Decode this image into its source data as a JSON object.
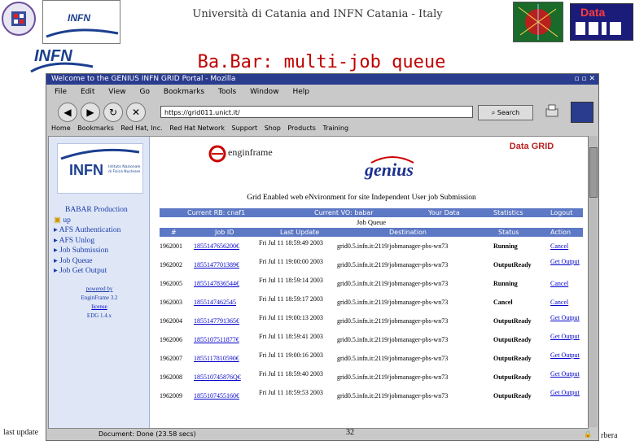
{
  "slide": {
    "header": "Università di Catania and INFN Catania - Italy",
    "title": "Ba.Bar: multi-job queue",
    "infn_logo": "INFN",
    "infn_logo2": "INFN",
    "datagrid_label": "Data",
    "footer_left": "last update",
    "page_number": "32",
    "footer_right": "rbera"
  },
  "browser": {
    "window_title": "Welcome to the GENIUS INFN GRID Portal - Mozilla",
    "menu": [
      "File",
      "Edit",
      "View",
      "Go",
      "Bookmarks",
      "Tools",
      "Window",
      "Help"
    ],
    "url": "https://grid011.unict.it/",
    "search_label": "Search",
    "bookmarks": [
      "Home",
      "Bookmarks",
      "Red Hat, Inc.",
      "Red Hat Network",
      "Support",
      "Shop",
      "Products",
      "Training"
    ],
    "status_text": "Document: Done (23.58 secs)"
  },
  "portal": {
    "sidebar_logo": "INFN",
    "sidebar_logo_sub": "Istituto Nazionale di Fisica Nucleare",
    "menu": [
      "BABAR Production",
      "up",
      "AFS Authentication",
      "AFS Unlog",
      "Job Submission",
      "Job Queue",
      "Job Get Output"
    ],
    "powered_by": "powered by",
    "engine": "EnginFrame 3.2",
    "engine_link": "license",
    "edg": "EDG 1.4.x",
    "enginframe_logo": "enginframe",
    "genius_logo": "genius",
    "banner": "Grid Enabled web eNvironment for site Independent User job Submission",
    "datagrid_logo": "Data GRID",
    "nav": [
      "Current RB: cnaf1",
      "Current VO: babar",
      "Your Data",
      "Statistics",
      "Logout"
    ],
    "queue_title": "Job Queue",
    "columns": [
      "#",
      "Job ID",
      "Last Update",
      "Destination",
      "Status",
      "Action"
    ],
    "rows": [
      {
        "num": "1962001",
        "jobid": "1855147656200€",
        "date": "Fri Jul 11 18:59:49 2003",
        "dest": "grid0.5.infn.it:2119/jobmanager-pbs-wn73",
        "status": "Running",
        "action": "Cancel"
      },
      {
        "num": "1962002",
        "jobid": "1855147701389€",
        "date": "Fri Jul 11 19:00:00 2003",
        "dest": "grid0.5.infn.it:2119/jobmanager-pbs-wn73",
        "status": "OutputReady",
        "action": "Get Output"
      },
      {
        "num": "1962005",
        "jobid": "1855147836544€",
        "date": "Fri Jul 11 18:59:14 2003",
        "dest": "grid0.5.infn.it:2119/jobmanager-pbs-wn73",
        "status": "Running",
        "action": "Cancel"
      },
      {
        "num": "1962003",
        "jobid": "1855147462545",
        "date": "Fri Jul 11 18:59:17 2003",
        "dest": "grid0.5.infn.it:2119/jobmanager-pbs-wn73",
        "status": "Cancel",
        "action": "Cancel"
      },
      {
        "num": "1962004",
        "jobid": "1855147791365€",
        "date": "Fri Jul 11 19:00:13 2003",
        "dest": "grid0.5.infn.it:2119/jobmanager-pbs-wn73",
        "status": "OutputReady",
        "action": "Get Output"
      },
      {
        "num": "1962006",
        "jobid": "1855107511877€",
        "date": "Fri Jul 11 18:59:41 2003",
        "dest": "grid0.5.infn.it:2119/jobmanager-pbs-wn73",
        "status": "OutputReady",
        "action": "Get Output"
      },
      {
        "num": "1962007",
        "jobid": "1855117810590€",
        "date": "Fri Jul 11 19:00:16 2003",
        "dest": "grid0.5.infn.it:2119/jobmanager-pbs-wn73",
        "status": "OutputReady",
        "action": "Get Output"
      },
      {
        "num": "1962008",
        "jobid": "185510745876Q€",
        "date": "Fri Jul 11 18:59:40 2003",
        "dest": "grid0.5.infn.it:2119/jobmanager-pbs-wn73",
        "status": "OutputReady",
        "action": "Get Output"
      },
      {
        "num": "1962009",
        "jobid": "1855107455160€",
        "date": "Fri Jul 11 18:59:53 2003",
        "dest": "grid0.5.infn.it:2119/jobmanager-pbs-wn73",
        "status": "OutputReady",
        "action": "Get Output"
      }
    ]
  },
  "colors": {
    "title_red": "#c00000",
    "infn_blue": "#1b3f8f",
    "portal_blue": "#5d78c4",
    "link_blue": "#0000cc"
  }
}
